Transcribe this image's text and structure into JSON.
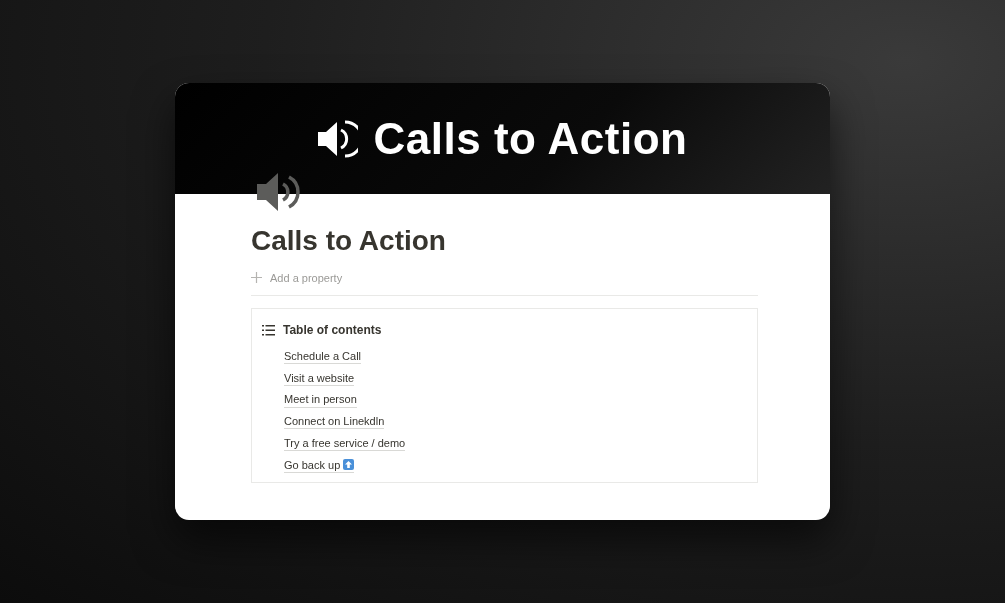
{
  "cover": {
    "title": "Calls to Action"
  },
  "page": {
    "title": "Calls to Action",
    "add_property": "Add a property"
  },
  "toc": {
    "heading": "Table of contents",
    "items": [
      {
        "label": "Schedule a Call",
        "kind": "link"
      },
      {
        "label": "Visit a website",
        "kind": "link"
      },
      {
        "label": "Meet in person",
        "kind": "link"
      },
      {
        "label": "Connect on Linekdln",
        "kind": "link"
      },
      {
        "label": "Try a free service / demo",
        "kind": "link"
      },
      {
        "label": "Go back up",
        "kind": "uplink"
      }
    ]
  }
}
